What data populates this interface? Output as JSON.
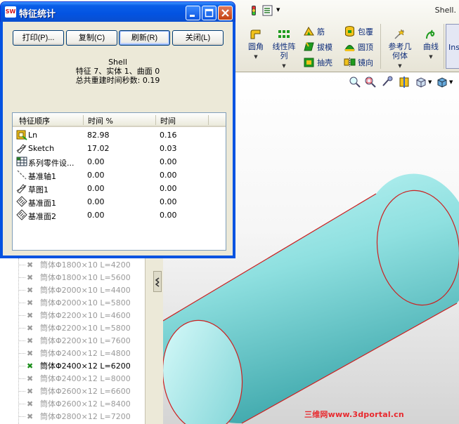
{
  "dialog": {
    "title": "特征统计",
    "buttons": {
      "print": "打印(P)...",
      "copy": "复制(C)",
      "refresh": "刷新(R)",
      "close": "关闭(L)"
    },
    "summary": {
      "part_name": "Shell",
      "counts": "特征 7、实体 1、曲面 0",
      "rebuild_time": "总共重建时间秒数: 0.19"
    },
    "table": {
      "columns": [
        "特征顺序",
        "时间 %",
        "时间"
      ],
      "rows": [
        {
          "icon": "loft-feature-icon",
          "name": "Ln",
          "pct": "82.98",
          "time": "0.16"
        },
        {
          "icon": "sketch-icon",
          "name": "Sketch",
          "pct": "17.02",
          "time": "0.03"
        },
        {
          "icon": "design-table-icon",
          "name": "系列零件设...",
          "pct": "0.00",
          "time": "0.00"
        },
        {
          "icon": "axis-icon",
          "name": "基准轴1",
          "pct": "0.00",
          "time": "0.00"
        },
        {
          "icon": "sketch-icon",
          "name": "草图1",
          "pct": "0.00",
          "time": "0.00"
        },
        {
          "icon": "plane-icon",
          "name": "基准面1",
          "pct": "0.00",
          "time": "0.00"
        },
        {
          "icon": "plane-icon",
          "name": "基准面2",
          "pct": "0.00",
          "time": "0.00"
        }
      ]
    }
  },
  "app": {
    "document_title": "Shell.",
    "commands": {
      "fillet": "圆角",
      "linear_pattern": "线性阵列",
      "rib": "筋",
      "draft": "拔模",
      "shell": "抽壳",
      "wrap": "包覆",
      "dome": "圆顶",
      "mirror": "镜向",
      "reference_geometry": "参考几何体",
      "curves": "曲线",
      "insert_tab": "Ins"
    },
    "configurations": [
      {
        "label": "筒体Φ1800×10 L=4200",
        "active": false
      },
      {
        "label": "筒体Φ1800×10 L=5600",
        "active": false
      },
      {
        "label": "筒体Φ2000×10 L=4400",
        "active": false
      },
      {
        "label": "筒体Φ2000×10 L=5800",
        "active": false
      },
      {
        "label": "筒体Φ2200×10 L=4600",
        "active": false
      },
      {
        "label": "筒体Φ2200×10 L=5800",
        "active": false
      },
      {
        "label": "筒体Φ2200×10 L=7600",
        "active": false
      },
      {
        "label": "筒体Φ2400×12 L=4800",
        "active": false
      },
      {
        "label": "筒体Φ2400×12 L=6200",
        "active": true
      },
      {
        "label": "筒体Φ2400×12 L=8000",
        "active": false
      },
      {
        "label": "筒体Φ2600×12 L=6600",
        "active": false
      },
      {
        "label": "筒体Φ2600×12 L=8400",
        "active": false
      },
      {
        "label": "筒体Φ2800×12 L=7200",
        "active": false
      }
    ]
  },
  "watermark": "三维网www.3dportal.cn",
  "colors": {
    "cylinder_fill": "#8fe0e0",
    "cylinder_edge": "#cc1f1f",
    "title_bar": "#0a5ee8",
    "watermark": "#e8282d"
  }
}
